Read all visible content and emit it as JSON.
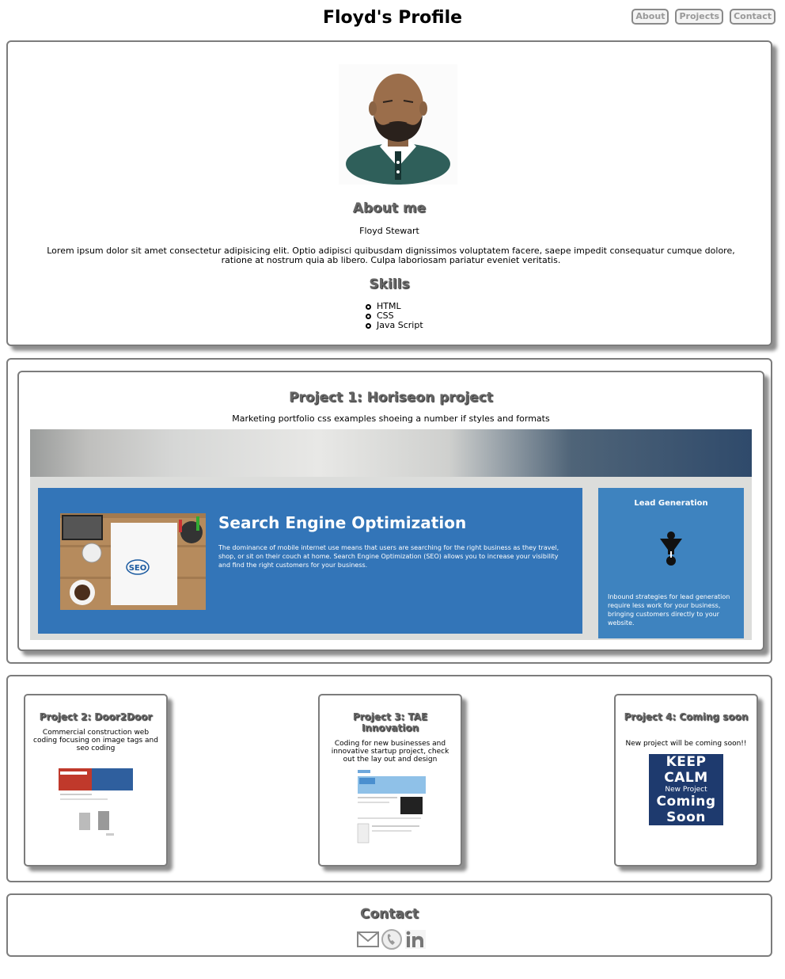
{
  "header": {
    "title": "Floyd's Profile",
    "nav": [
      "About",
      "Projects",
      "Contact"
    ]
  },
  "about": {
    "heading": "About me",
    "name": "Floyd Stewart",
    "bio": "Lorem ipsum dolor sit amet consectetur adipisicing elit. Optio adipisci quibusdam dignissimos voluptatem facere, saepe impedit consequatur cumque dolore, ratione at nostrum quia ab libero. Culpa laboriosam pariatur eveniet veritatis.",
    "skills_heading": "Skills",
    "skills": [
      "HTML",
      "CSS",
      "Java Script"
    ]
  },
  "project1": {
    "title": "Project 1: Horiseon project",
    "description": "Marketing portfolio css examples shoeing a number if styles and formats",
    "screenshot": {
      "seo_title": "Search Engine Optimization",
      "seo_text": "The dominance of mobile internet use means that users are searching for the right business as they travel, shop, or sit on their couch at home. Search Engine Optimization (SEO) allows you to increase your visibility and find the right customers for your business.",
      "seo_badge": "SEO",
      "lead_title": "Lead Generation",
      "lead_text": "Inbound strategies for lead generation require less work for your business, bringing customers directly to your website."
    }
  },
  "projects": [
    {
      "title": "Project 2: Door2Door",
      "description": "Commercial construction web coding focusing on image tags and seo coding"
    },
    {
      "title": "Project 3: TAE Innovation",
      "description": "Coding for new businesses and innovative startup project, check out the lay out and design"
    },
    {
      "title": "Project 4: Coming soon",
      "description": "New project will be coming soon!!",
      "image_lines": [
        "KEEP",
        "CALM",
        "New Project",
        "Coming",
        "Soon"
      ]
    }
  ],
  "contact": {
    "heading": "Contact",
    "icons": [
      "mail-icon",
      "phone-icon",
      "linkedin-icon"
    ]
  },
  "colors": {
    "panel_border": "#7c7c7c",
    "seo_blue": "#3375b8",
    "lead_blue": "#3e83bf",
    "heading_gray": "#666666"
  }
}
